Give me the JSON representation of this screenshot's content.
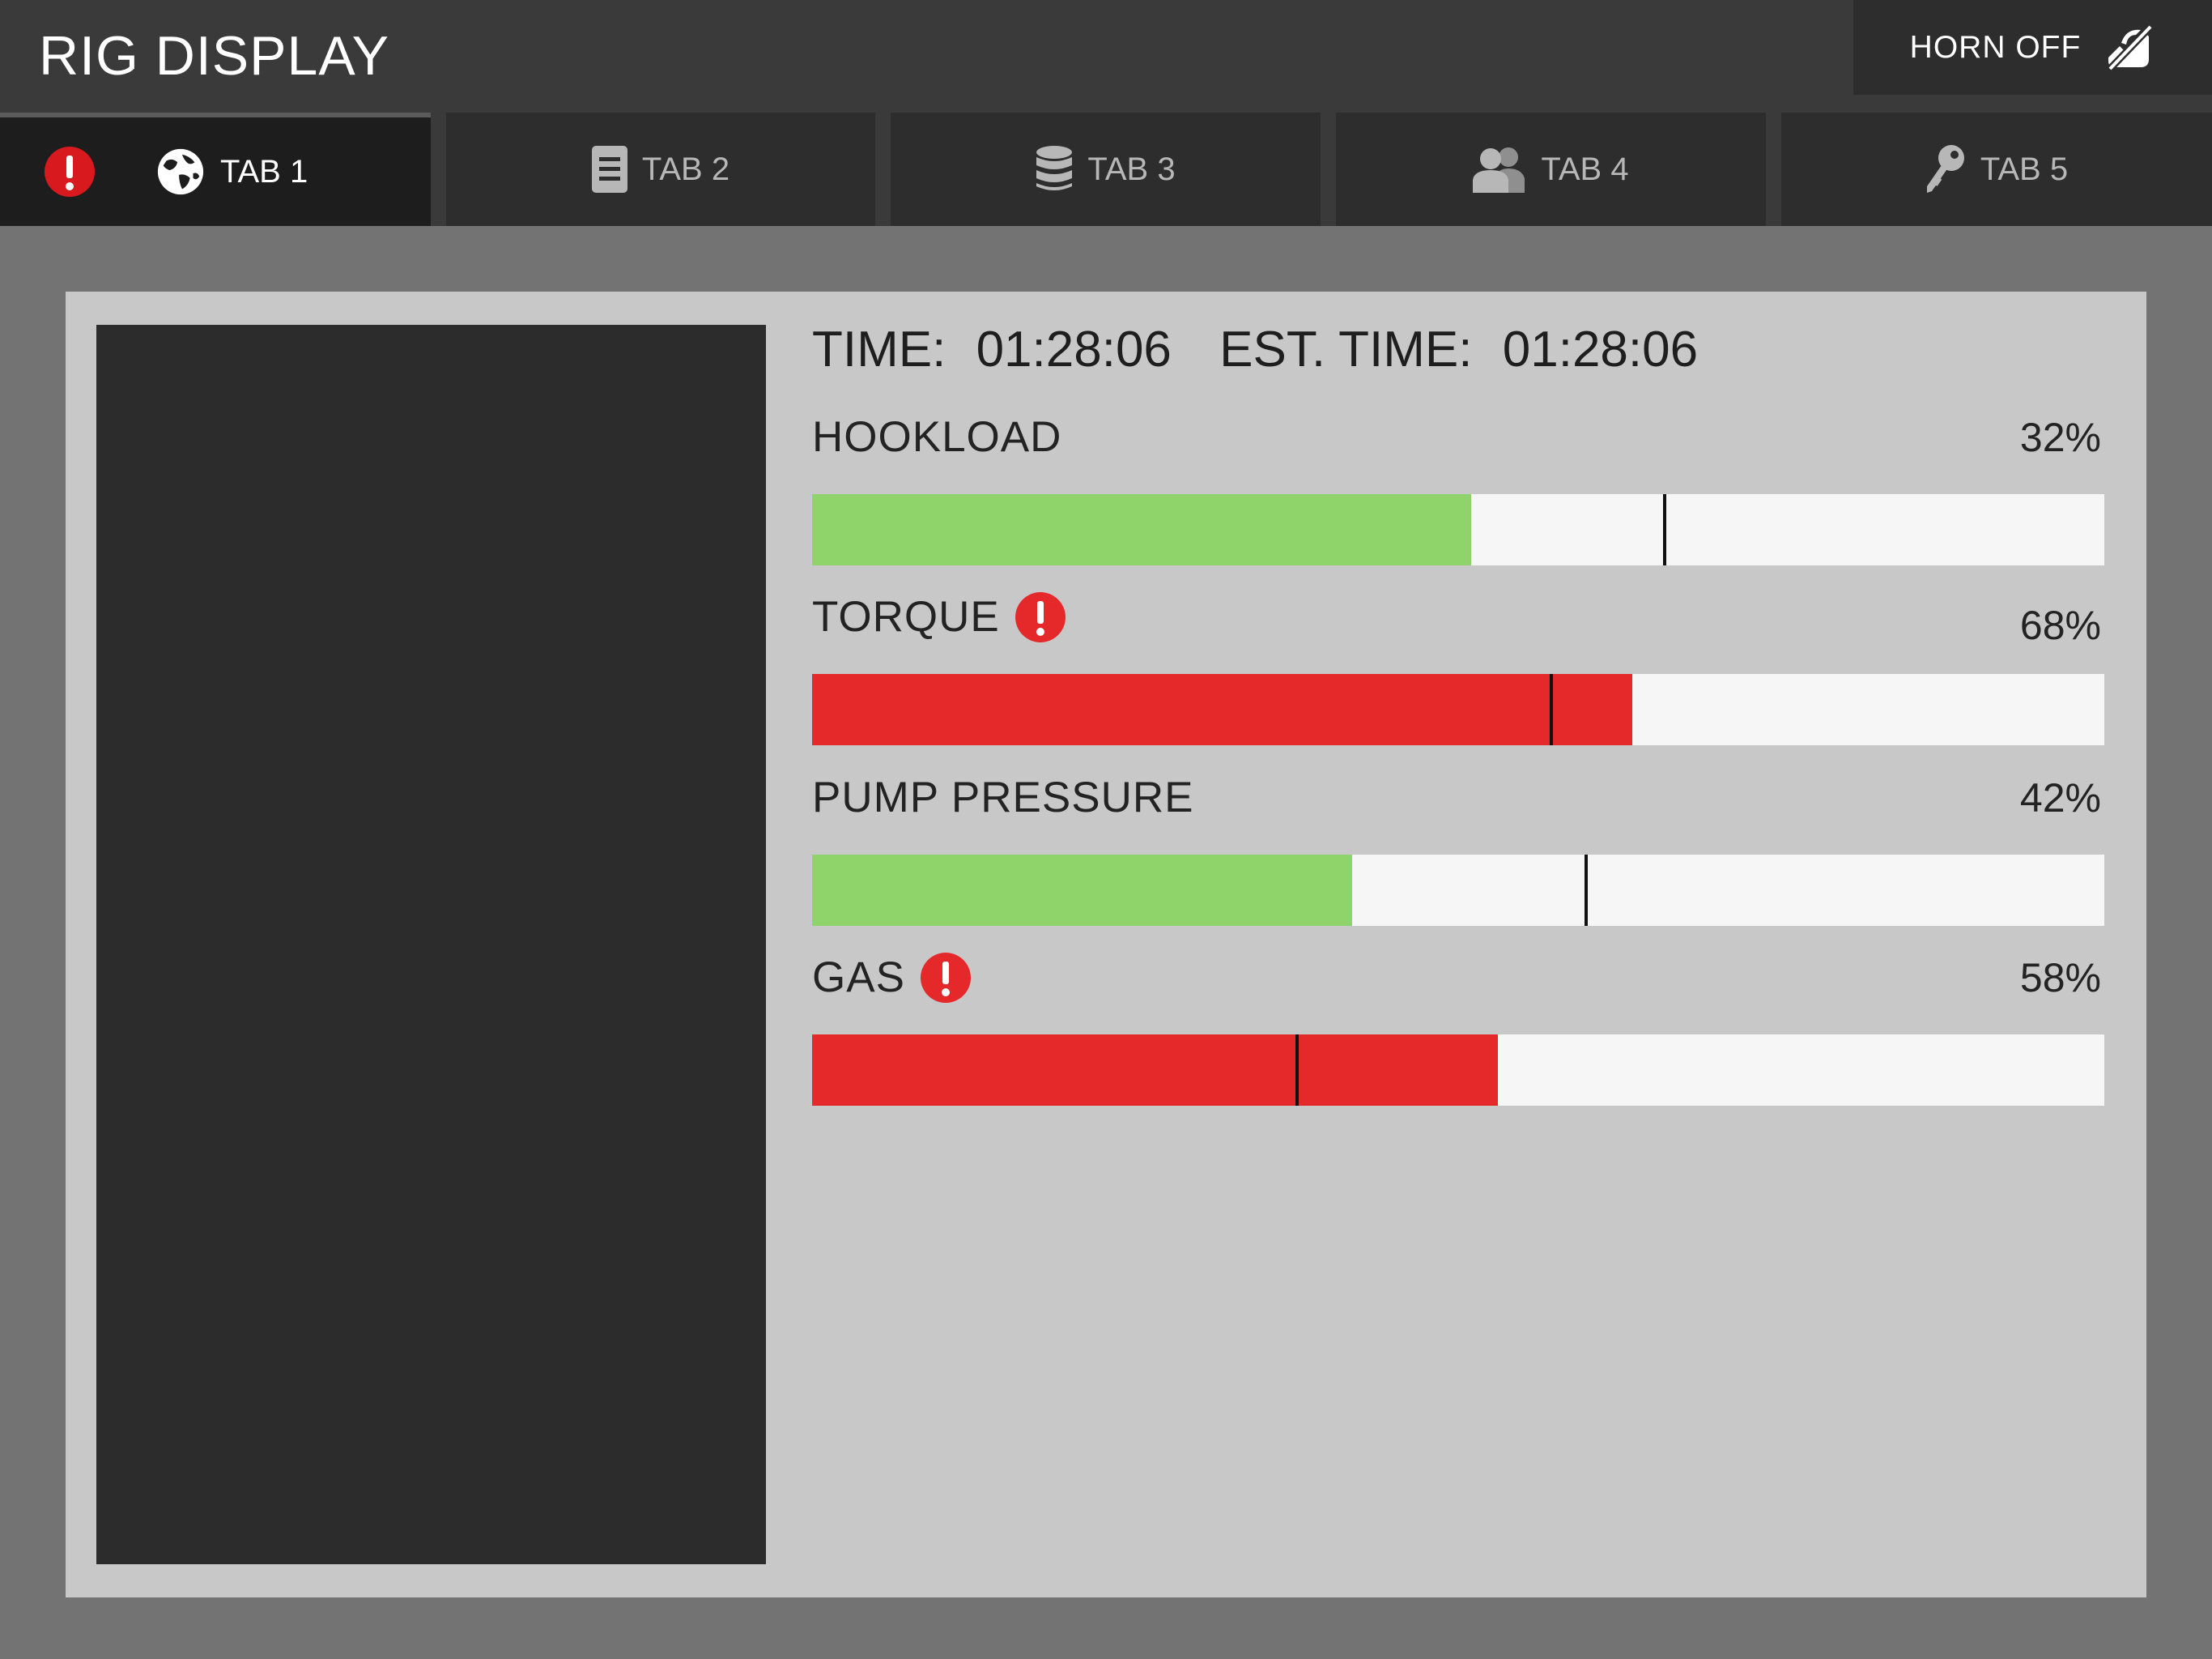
{
  "header": {
    "title": "RIG DISPLAY",
    "horn_label": "HORN OFF",
    "horn_icon": "horn-off-icon"
  },
  "tabs": [
    {
      "label": "TAB 1",
      "icon": "globe-icon",
      "active": true,
      "alert": true
    },
    {
      "label": "TAB 2",
      "icon": "document-icon",
      "active": false,
      "alert": false
    },
    {
      "label": "TAB 3",
      "icon": "database-icon",
      "active": false,
      "alert": false
    },
    {
      "label": "TAB 4",
      "icon": "users-icon",
      "active": false,
      "alert": false
    },
    {
      "label": "TAB 5",
      "icon": "key-icon",
      "active": false,
      "alert": false
    }
  ],
  "status": {
    "time_label": "TIME:",
    "time_value": "01:28:06",
    "est_label": "EST. TIME:",
    "est_value": "01:28:06"
  },
  "metrics": [
    {
      "label": "HOOKLOAD",
      "value": "32%",
      "alert": false,
      "fill": 0.51,
      "marker": 0.66,
      "color": "#8fd46b"
    },
    {
      "label": "TORQUE",
      "value": "68%",
      "alert": true,
      "fill": 0.635,
      "marker": 0.572,
      "color": "#e5292b"
    },
    {
      "label": "PUMP PRESSURE",
      "value": "42%",
      "alert": false,
      "fill": 0.418,
      "marker": 0.599,
      "color": "#8fd46b"
    },
    {
      "label": "GAS",
      "value": "58%",
      "alert": true,
      "fill": 0.531,
      "marker": 0.375,
      "color": "#e5292b"
    }
  ],
  "colors": {
    "ok": "#8fd46b",
    "alarm": "#e5292b",
    "alert_icon": "#d8191e"
  }
}
